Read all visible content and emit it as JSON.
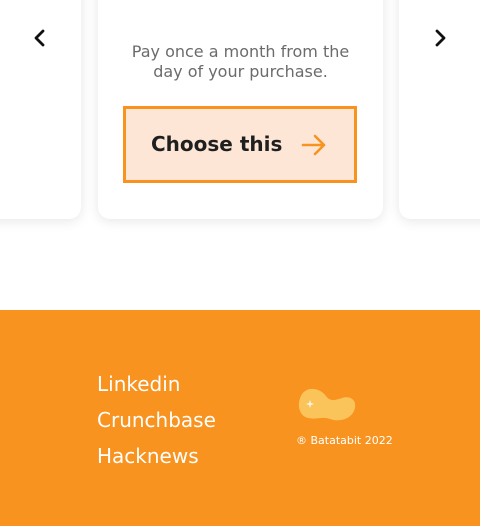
{
  "pricing": {
    "description_line1": "Pay once a month from the",
    "description_line2": "day of your purchase.",
    "choose_label": "Choose this"
  },
  "carousel": {
    "prev_icon": "chevron-left-icon",
    "next_icon": "chevron-right-icon"
  },
  "footer": {
    "links": [
      "Linkedin",
      "Crunchbase",
      "Hacknews"
    ],
    "copyright": "® Batatabit 2022",
    "logo_icon": "batatabit-logo-icon"
  },
  "colors": {
    "accent": "#f7931e",
    "button_bg": "#fde6d6",
    "text_dark": "#1f1f1f",
    "text_muted": "#6b6b6b",
    "footer_text": "#ffffff"
  }
}
